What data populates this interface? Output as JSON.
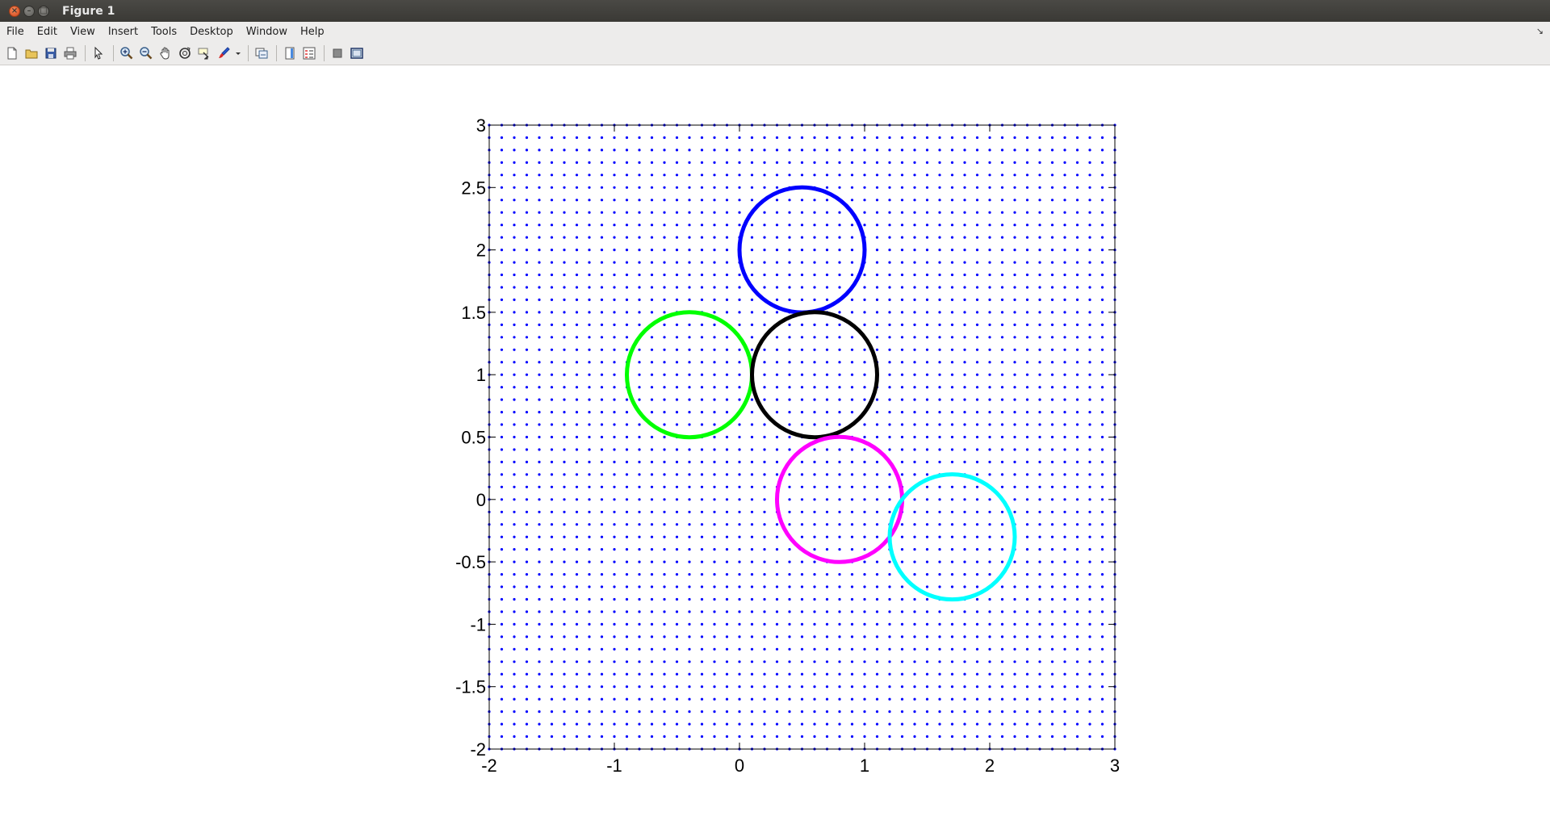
{
  "window": {
    "title": "Figure 1",
    "controls": {
      "close": "×",
      "minimize": "–",
      "maximize": "□"
    }
  },
  "menubar": {
    "items": [
      "File",
      "Edit",
      "View",
      "Insert",
      "Tools",
      "Desktop",
      "Window",
      "Help"
    ],
    "corner": "↘"
  },
  "toolbar": {
    "items": [
      {
        "name": "new-figure-icon"
      },
      {
        "name": "open-file-icon"
      },
      {
        "name": "save-icon"
      },
      {
        "name": "print-icon"
      },
      {
        "sep": true
      },
      {
        "name": "edit-plot-arrow-icon"
      },
      {
        "sep": true
      },
      {
        "name": "zoom-in-icon"
      },
      {
        "name": "zoom-out-icon"
      },
      {
        "name": "pan-hand-icon"
      },
      {
        "name": "rotate-3d-icon"
      },
      {
        "name": "data-cursor-icon"
      },
      {
        "name": "brush-icon"
      },
      {
        "name": "dropdown-arrow-icon"
      },
      {
        "sep": true
      },
      {
        "name": "link-plot-icon"
      },
      {
        "sep": true
      },
      {
        "name": "insert-colorbar-icon"
      },
      {
        "name": "insert-legend-icon"
      },
      {
        "sep": true
      },
      {
        "name": "hide-plot-tools-icon"
      },
      {
        "name": "show-plot-tools-icon"
      }
    ]
  },
  "chart_data": {
    "type": "scatter",
    "title": "",
    "xlabel": "",
    "ylabel": "",
    "xlim": [
      -2,
      3
    ],
    "ylim": [
      -2,
      3
    ],
    "grid": false,
    "xticks": [
      -2,
      -1,
      0,
      1,
      2,
      3
    ],
    "xtick_labels": [
      "-2",
      "-1",
      "0",
      "1",
      "2",
      "3"
    ],
    "yticks": [
      -2,
      -1.5,
      -1,
      -0.5,
      0,
      0.5,
      1,
      1.5,
      2,
      2.5,
      3
    ],
    "ytick_labels": [
      "-2",
      "-1.5",
      "-1",
      "-0.5",
      "0",
      "0.5",
      "1",
      "1.5",
      "2",
      "2.5",
      "3"
    ],
    "point_grid": {
      "start": -2,
      "end": 3,
      "step": 0.1,
      "color": "#0000ff",
      "marker": "."
    },
    "circles": [
      {
        "color": "#0000ff",
        "cx": 0.5,
        "cy": 2.0,
        "r": 0.5
      },
      {
        "color": "#00ff00",
        "cx": -0.4,
        "cy": 1.0,
        "r": 0.5
      },
      {
        "color": "#000000",
        "cx": 0.6,
        "cy": 1.0,
        "r": 0.5
      },
      {
        "color": "#ff00ff",
        "cx": 0.8,
        "cy": 0.0,
        "r": 0.5
      },
      {
        "color": "#00ffff",
        "cx": 1.7,
        "cy": -0.3,
        "r": 0.5
      }
    ]
  }
}
